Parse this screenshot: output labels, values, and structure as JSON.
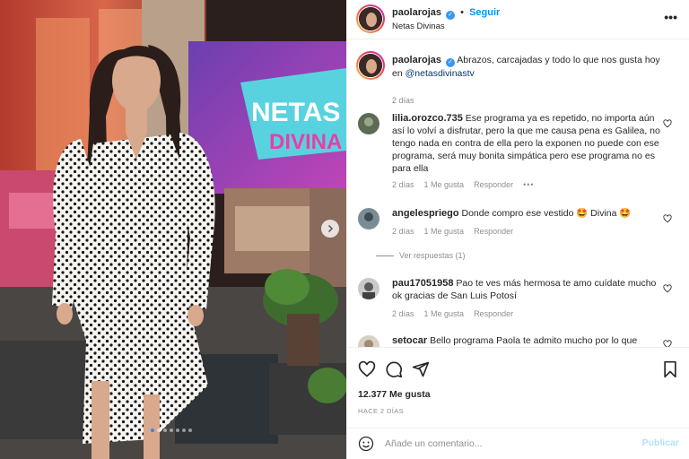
{
  "post": {
    "username": "paolarojas",
    "follow_label": "Seguir",
    "location": "Netas Divinas",
    "caption_text": "Abrazos, carcajadas y todo lo que nos gusta hoy en",
    "caption_mention": "@netasdivinastv",
    "caption_time": "2 días",
    "tv_sign_line1": "NETAS",
    "tv_sign_line2": "DIVINA",
    "carousel_count": 7,
    "carousel_active_index": 0
  },
  "comments": [
    {
      "username": "lilia.orozco.735",
      "text": "Ese programa ya es repetido, no importa aún así lo volví a disfrutar, pero la que me causa pena es Galilea, no tengo nada en contra de ella pero la exponen no puede con ese programa, será muy bonita simpática pero ese programa no es para ella",
      "time": "2 días",
      "likes": "1 Me gusta",
      "reply": "Responder",
      "more": "•••"
    },
    {
      "username": "angelespriego",
      "text": "Donde compro ese vestido 🤩 Divina 🤩",
      "time": "2 días",
      "likes": "1 Me gusta",
      "reply": "Responder",
      "view_replies": "Ver respuestas (1)"
    },
    {
      "username": "pau17051958",
      "text": "Pao te ves más hermosa te amo cuídate mucho ok gracias de San Luis Potosí",
      "time": "2 días",
      "likes": "1 Me gusta",
      "reply": "Responder"
    },
    {
      "username": "setocar",
      "text": "Bello programa Paola te admito mucho por lo que"
    }
  ],
  "footer": {
    "likes": "12.377 Me gusta",
    "date": "HACE 2 DÍAS",
    "comment_placeholder": "Añade un comentario...",
    "post_label": "Publicar"
  },
  "icons": {
    "more": "more-options-icon",
    "heart": "heart-icon",
    "comment": "comment-icon",
    "share": "share-icon",
    "save": "bookmark-icon",
    "emoji": "emoji-icon",
    "next": "chevron-right-icon"
  },
  "colors": {
    "link": "#0095f6",
    "verified": "#3897f0",
    "meta": "#8e8e8e",
    "publish_disabled": "#b2dffc",
    "carousel_active": "#3b82f6"
  }
}
